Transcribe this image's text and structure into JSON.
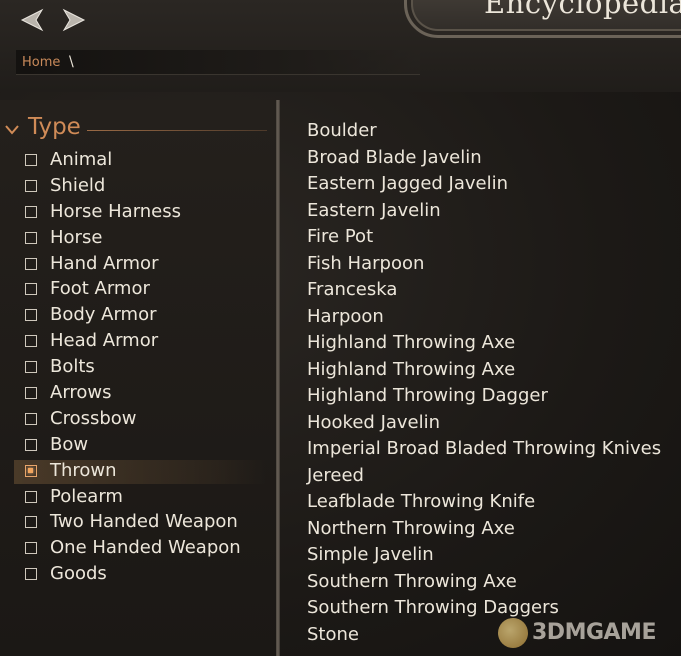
{
  "header": {
    "title": "Encyclopedia",
    "back_icon": "back-arrow-icon",
    "forward_icon": "forward-arrow-icon"
  },
  "breadcrumb": {
    "home": "Home",
    "separator": "\\"
  },
  "sidebar": {
    "section_title": "Type",
    "filters": [
      {
        "label": "Animal",
        "checked": false
      },
      {
        "label": "Shield",
        "checked": false
      },
      {
        "label": "Horse Harness",
        "checked": false
      },
      {
        "label": "Horse",
        "checked": false
      },
      {
        "label": "Hand Armor",
        "checked": false
      },
      {
        "label": "Foot Armor",
        "checked": false
      },
      {
        "label": "Body Armor",
        "checked": false
      },
      {
        "label": "Head Armor",
        "checked": false
      },
      {
        "label": "Bolts",
        "checked": false
      },
      {
        "label": "Arrows",
        "checked": false
      },
      {
        "label": "Crossbow",
        "checked": false
      },
      {
        "label": "Bow",
        "checked": false
      },
      {
        "label": "Thrown",
        "checked": true
      },
      {
        "label": "Polearm",
        "checked": false
      },
      {
        "label": "Two Handed Weapon",
        "checked": false
      },
      {
        "label": "One Handed Weapon",
        "checked": false
      },
      {
        "label": "Goods",
        "checked": false
      }
    ]
  },
  "items": [
    "Boulder",
    "Broad Blade Javelin",
    "Eastern Jagged Javelin",
    "Eastern Javelin",
    "Fire Pot",
    "Fish Harpoon",
    "Franceska",
    "Harpoon",
    "Highland Throwing Axe",
    "Highland Throwing Axe",
    "Highland Throwing Dagger",
    "Hooked Javelin",
    "Imperial Broad Bladed Throwing Knives",
    "Jereed",
    "Leafblade Throwing Knife",
    "Northern Throwing Axe",
    "Simple Javelin",
    "Southern Throwing Axe",
    "Southern Throwing Daggers",
    "Stone"
  ],
  "watermark": {
    "text": "3DMGAME"
  },
  "colors": {
    "accent": "#d08b57",
    "text": "#ece6da",
    "breadcrumb_link": "#c98a5a",
    "checkbox_selected": "#f0a55e"
  }
}
